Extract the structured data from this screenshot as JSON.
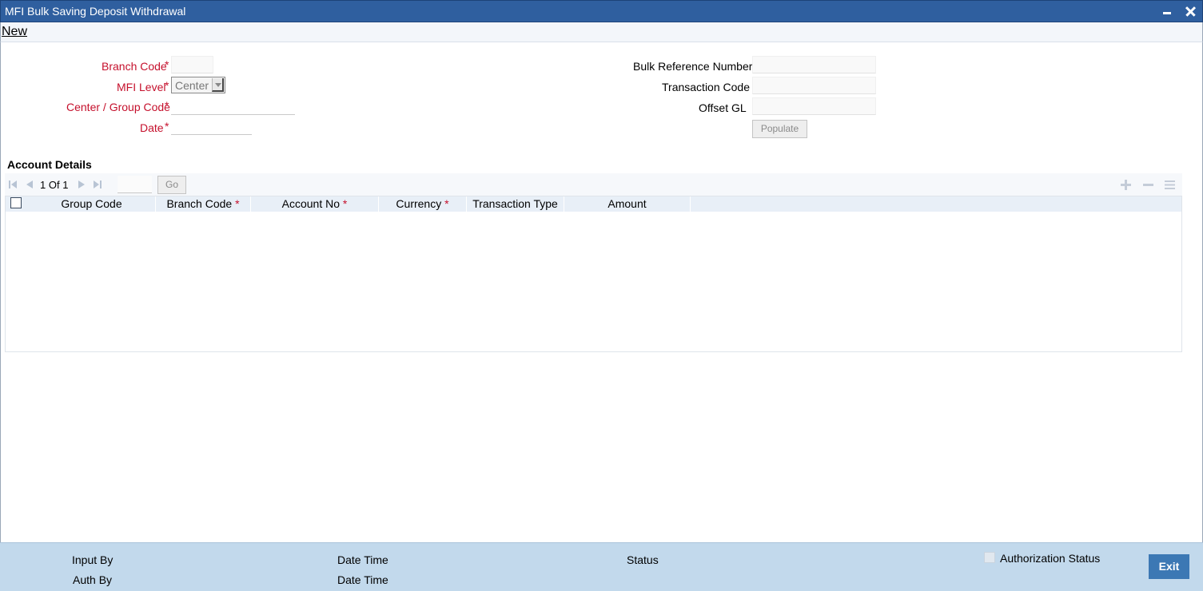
{
  "window": {
    "title": "MFI Bulk Saving Deposit Withdrawal"
  },
  "menu": {
    "new_label": "New"
  },
  "form_left": {
    "branch_code_label": "Branch Code",
    "mfi_level_label": "MFI Level",
    "mfi_level_value": "Center",
    "center_group_code_label": "Center / Group Code",
    "date_label": "Date",
    "required_mark": "*"
  },
  "form_right": {
    "bulk_reference_label": "Bulk Reference Number",
    "transaction_code_label": "Transaction Code",
    "offset_gl_label": "Offset GL",
    "populate_label": "Populate"
  },
  "account_details": {
    "title": "Account Details",
    "pagination": {
      "current": "1",
      "of_label": "Of",
      "total": "1",
      "go_label": "Go"
    },
    "columns": [
      {
        "label": "Group Code",
        "required": ""
      },
      {
        "label": "Branch Code",
        "required": "*"
      },
      {
        "label": "Account No",
        "required": "*"
      },
      {
        "label": "Currency",
        "required": "*"
      },
      {
        "label": "Transaction Type",
        "required": ""
      },
      {
        "label": "Amount",
        "required": ""
      }
    ]
  },
  "footer": {
    "input_by_label": "Input By",
    "date_time_label": "Date Time",
    "status_label": "Status",
    "auth_by_label": "Auth By",
    "date_time_label_2": "Date Time",
    "authorization_status_label": "Authorization Status",
    "exit_label": "Exit"
  }
}
